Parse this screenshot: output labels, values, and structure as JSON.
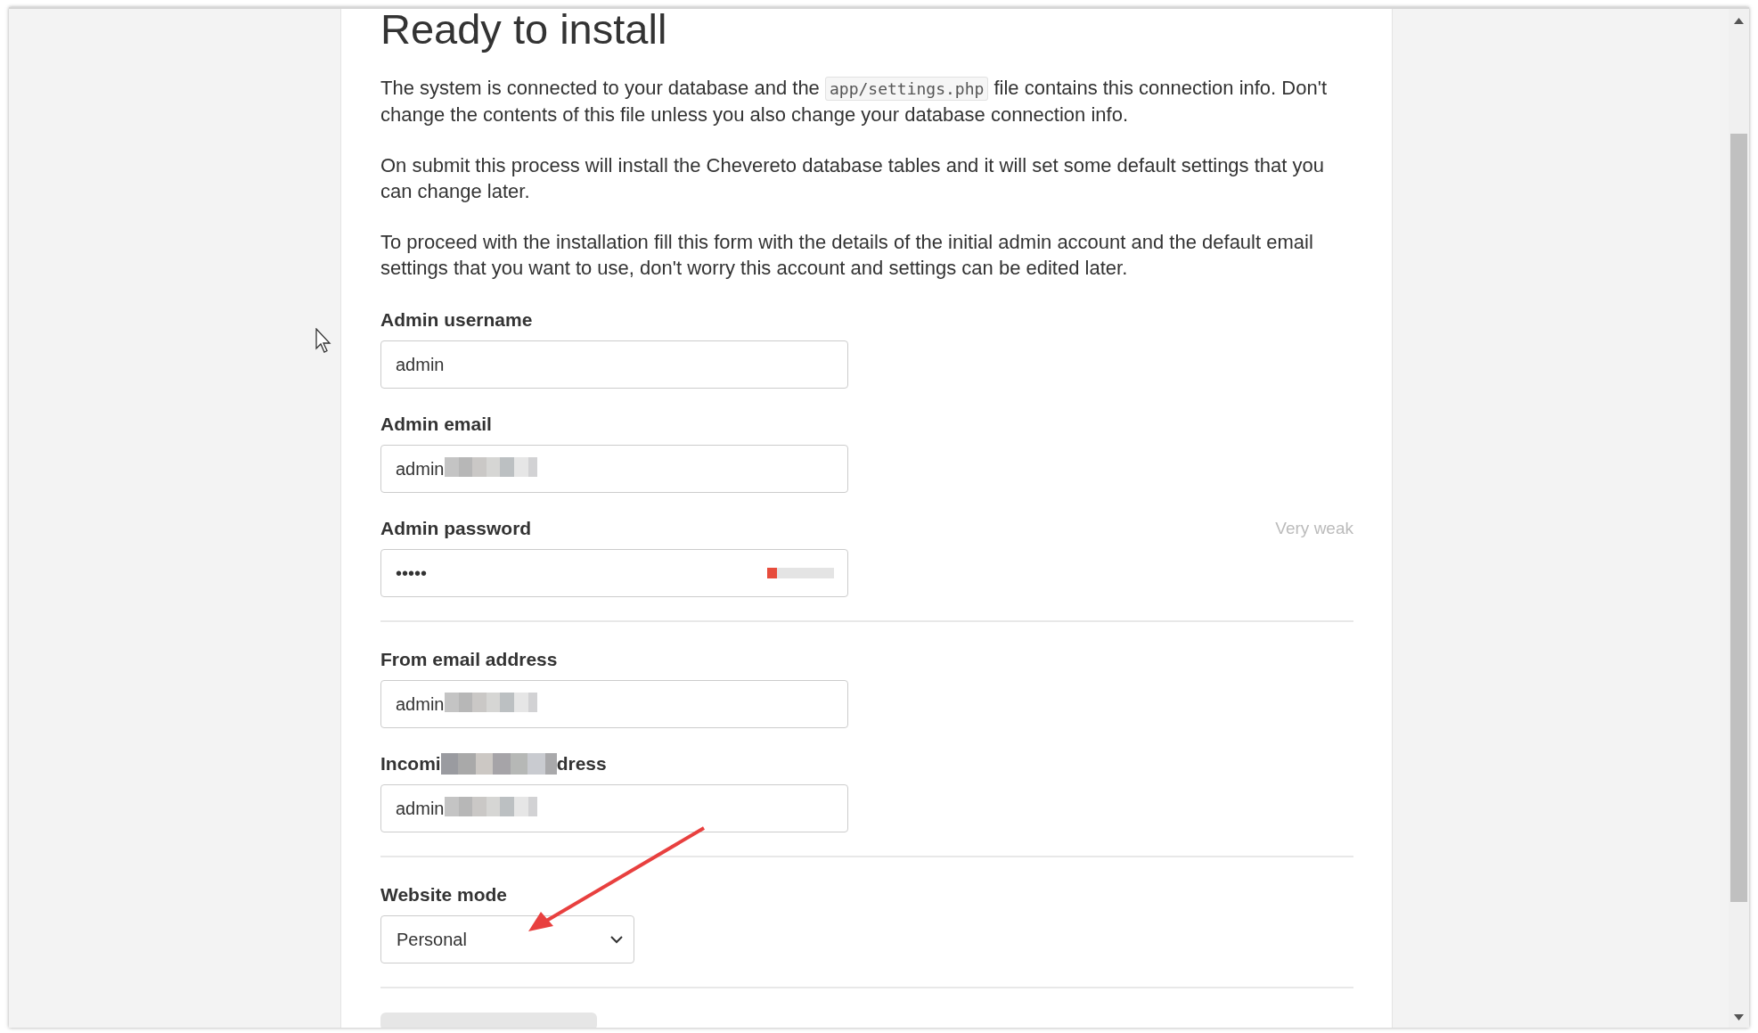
{
  "heading": "Ready to install",
  "paragraphs": [
    {
      "parts": [
        {
          "kind": "text",
          "text": "The system is connected to your database and the "
        },
        {
          "kind": "code",
          "text": "app/settings.php"
        },
        {
          "kind": "text",
          "text": " file contains this connection info. Don't change the contents of this file unless you also change your database connection info."
        }
      ]
    },
    {
      "parts": [
        {
          "kind": "text",
          "text": "On submit this process will install the Chevereto database tables and it will set some default settings that you can change later."
        }
      ]
    },
    {
      "parts": [
        {
          "kind": "text",
          "text": "To proceed with the installation fill this form with the details of the initial admin account and the default email settings that you want to use, don't worry this account and settings can be edited later."
        }
      ]
    }
  ],
  "sections": [
    {
      "fields": [
        {
          "kind": "text",
          "label": [
            "Admin username"
          ],
          "value": "admin",
          "redacted": false
        },
        {
          "kind": "text",
          "label": [
            "Admin email"
          ],
          "value": "admin",
          "redacted": true
        },
        {
          "kind": "password",
          "label": [
            "Admin password"
          ],
          "value": "•••••",
          "strength_label": "Very weak",
          "level": 0.15
        }
      ]
    },
    {
      "fields": [
        {
          "kind": "text",
          "label": [
            "From email address"
          ],
          "value": "admin",
          "redacted": true
        },
        {
          "kind": "text",
          "label": [
            "Incomi",
            "dress"
          ],
          "value": "admin",
          "redacted": true
        }
      ]
    },
    {
      "fields": [
        {
          "kind": "select",
          "label": [
            "Website mode"
          ],
          "value": "Personal"
        }
      ]
    }
  ],
  "annotation": {
    "kind": "arrow",
    "color": "#e8403f"
  }
}
